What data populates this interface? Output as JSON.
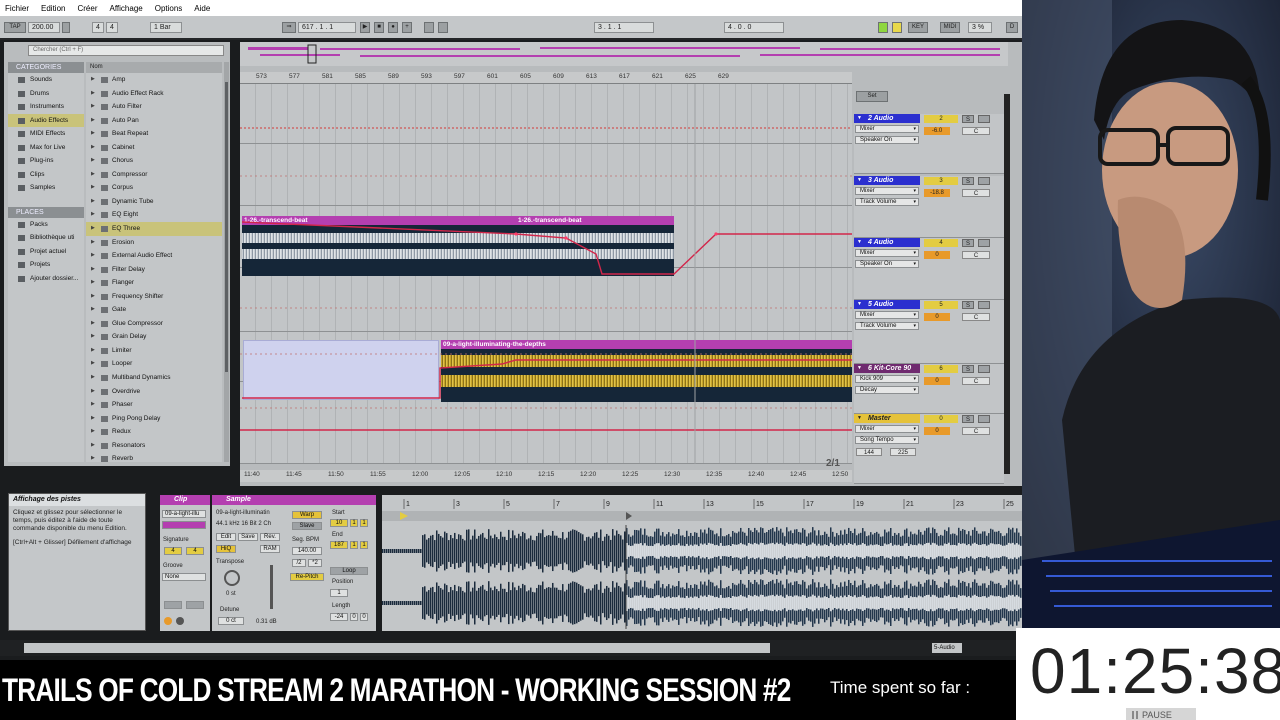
{
  "menu": [
    "Fichier",
    "Edition",
    "Créer",
    "Affichage",
    "Options",
    "Aide"
  ],
  "transport": {
    "tap": "TAP",
    "tempo": "200.00",
    "sig_num": "4",
    "sig_den": "4",
    "quant": "1 Bar",
    "position": "617 .   1 .   1",
    "loop_start": "3 .   1 .   1",
    "loop_len": "4 .   0 .   0",
    "key": "KEY",
    "midi": "MIDI",
    "cpu": "3 %",
    "d": "D"
  },
  "browser": {
    "search_placeholder": "Chercher (Ctrl + F)",
    "categories_title": "CATEGORIES",
    "categories": [
      "Sounds",
      "Drums",
      "Instruments",
      "Audio Effects",
      "MIDI Effects",
      "Max for Live",
      "Plug-ins",
      "Clips",
      "Samples"
    ],
    "places_title": "PLACES",
    "places": [
      "Packs",
      "Bibliothèque uti",
      "Projet actuel",
      "Projets",
      "Ajouter dossier..."
    ],
    "list_header": "Nom",
    "items": [
      "Amp",
      "Audio Effect Rack",
      "Auto Filter",
      "Auto Pan",
      "Beat Repeat",
      "Cabinet",
      "Chorus",
      "Compressor",
      "Corpus",
      "Dynamic Tube",
      "EQ Eight",
      "EQ Three",
      "Erosion",
      "External Audio Effect",
      "Filter Delay",
      "Flanger",
      "Frequency Shifter",
      "Gate",
      "Glue Compressor",
      "Grain Delay",
      "Limiter",
      "Looper",
      "Multiband Dynamics",
      "Overdrive",
      "Phaser",
      "Ping Pong Delay",
      "Redux",
      "Resonators",
      "Reverb"
    ]
  },
  "arrangement": {
    "bars": [
      "573",
      "577",
      "581",
      "585",
      "589",
      "593",
      "597",
      "601",
      "605",
      "609",
      "613",
      "617",
      "621",
      "625",
      "629"
    ],
    "times": [
      "11:40",
      "11:45",
      "11:50",
      "11:55",
      "12:00",
      "12:05",
      "12:10",
      "12:15",
      "12:20",
      "12:25",
      "12:30",
      "12:35",
      "12:40",
      "12:45",
      "12:50"
    ],
    "page": "2/1",
    "set_label": "Set",
    "clips": {
      "beat_a": "1-26.-transcend-beat",
      "beat_b": "1-26.-transcend-beat",
      "light": "09-a-light-illuminating-the-depths"
    }
  },
  "tracks": [
    {
      "name": "2 Audio",
      "d1": "Mixer",
      "d2": "Speaker On",
      "num": "2",
      "vol": "-6.0",
      "pan": "C"
    },
    {
      "name": "3 Audio",
      "d1": "Mixer",
      "d2": "Track Volume",
      "num": "3",
      "vol": "-18.8",
      "pan": "C"
    },
    {
      "name": "4 Audio",
      "d1": "Mixer",
      "d2": "Speaker On",
      "num": "4",
      "vol": "0",
      "pan": "C"
    },
    {
      "name": "5 Audio",
      "d1": "Mixer",
      "d2": "Track Volume",
      "num": "5",
      "vol": "0",
      "pan": "C"
    },
    {
      "name": "6 Kit-Core 90",
      "d1": "Kick 909",
      "d2": "Decay",
      "num": "6",
      "vol": "0",
      "pan": "C"
    },
    {
      "name": "Master",
      "d1": "Mixer",
      "d2": "Song Tempo",
      "num": "0",
      "vol": "0",
      "pan": "C",
      "v1": "144",
      "v2": "225"
    }
  ],
  "solo": "S",
  "info": {
    "title": "Affichage des pistes",
    "text1": "Cliquez et glissez pour sélectionner le temps, puis éditez à l'aide de toute commande disponible du menu Edition.",
    "text2": "[Ctrl+Alt + Glisser] Défilement d'affichage"
  },
  "clip_panel": {
    "title": "Clip",
    "name": "09-a-light-illu",
    "signature": "Signature",
    "sig_num": "4",
    "sig_den": "4",
    "groove": "Groove",
    "groove_val": "None"
  },
  "sample_panel": {
    "title": "Sample",
    "file": "09-a-light-illuminatin",
    "format": "44.1 kHz 16 Bit 2 Ch",
    "edit": "Edit",
    "save": "Save",
    "rev": "Rev.",
    "hiq": "HiQ",
    "ram": "RAM",
    "warp": "Warp",
    "slave": "Slave",
    "seg_bpm": "Seg. BPM",
    "bpm": "140.00",
    "transpose": "Transpose",
    "transpose_val": "0 st",
    "detune": "Detune",
    "detune_val": "0 ct",
    "gain_val": "0.31 dB",
    "mode": "Re-Pitch",
    "start": "Start",
    "start_val": "10",
    "end": "End",
    "end_val": "187",
    "loop": "Loop",
    "position": "Position",
    "length": "Length",
    "length_val": "-24",
    "one": "1",
    "zero": "0",
    "x2a": "/2",
    "x2b": "*2"
  },
  "sample_view": {
    "ticks": [
      "1",
      "3",
      "5",
      "7",
      "9",
      "11",
      "13",
      "15",
      "17",
      "19",
      "21",
      "23",
      "25"
    ]
  },
  "statusbar": {
    "track": "5-Audio"
  },
  "overlay": {
    "title": "TRAILS OF COLD STREAM 2 MARATHON - WORKING SESSION #2",
    "time_label": "Time spent so far :",
    "timer": "01:25:38",
    "pause": "PAUSE"
  }
}
